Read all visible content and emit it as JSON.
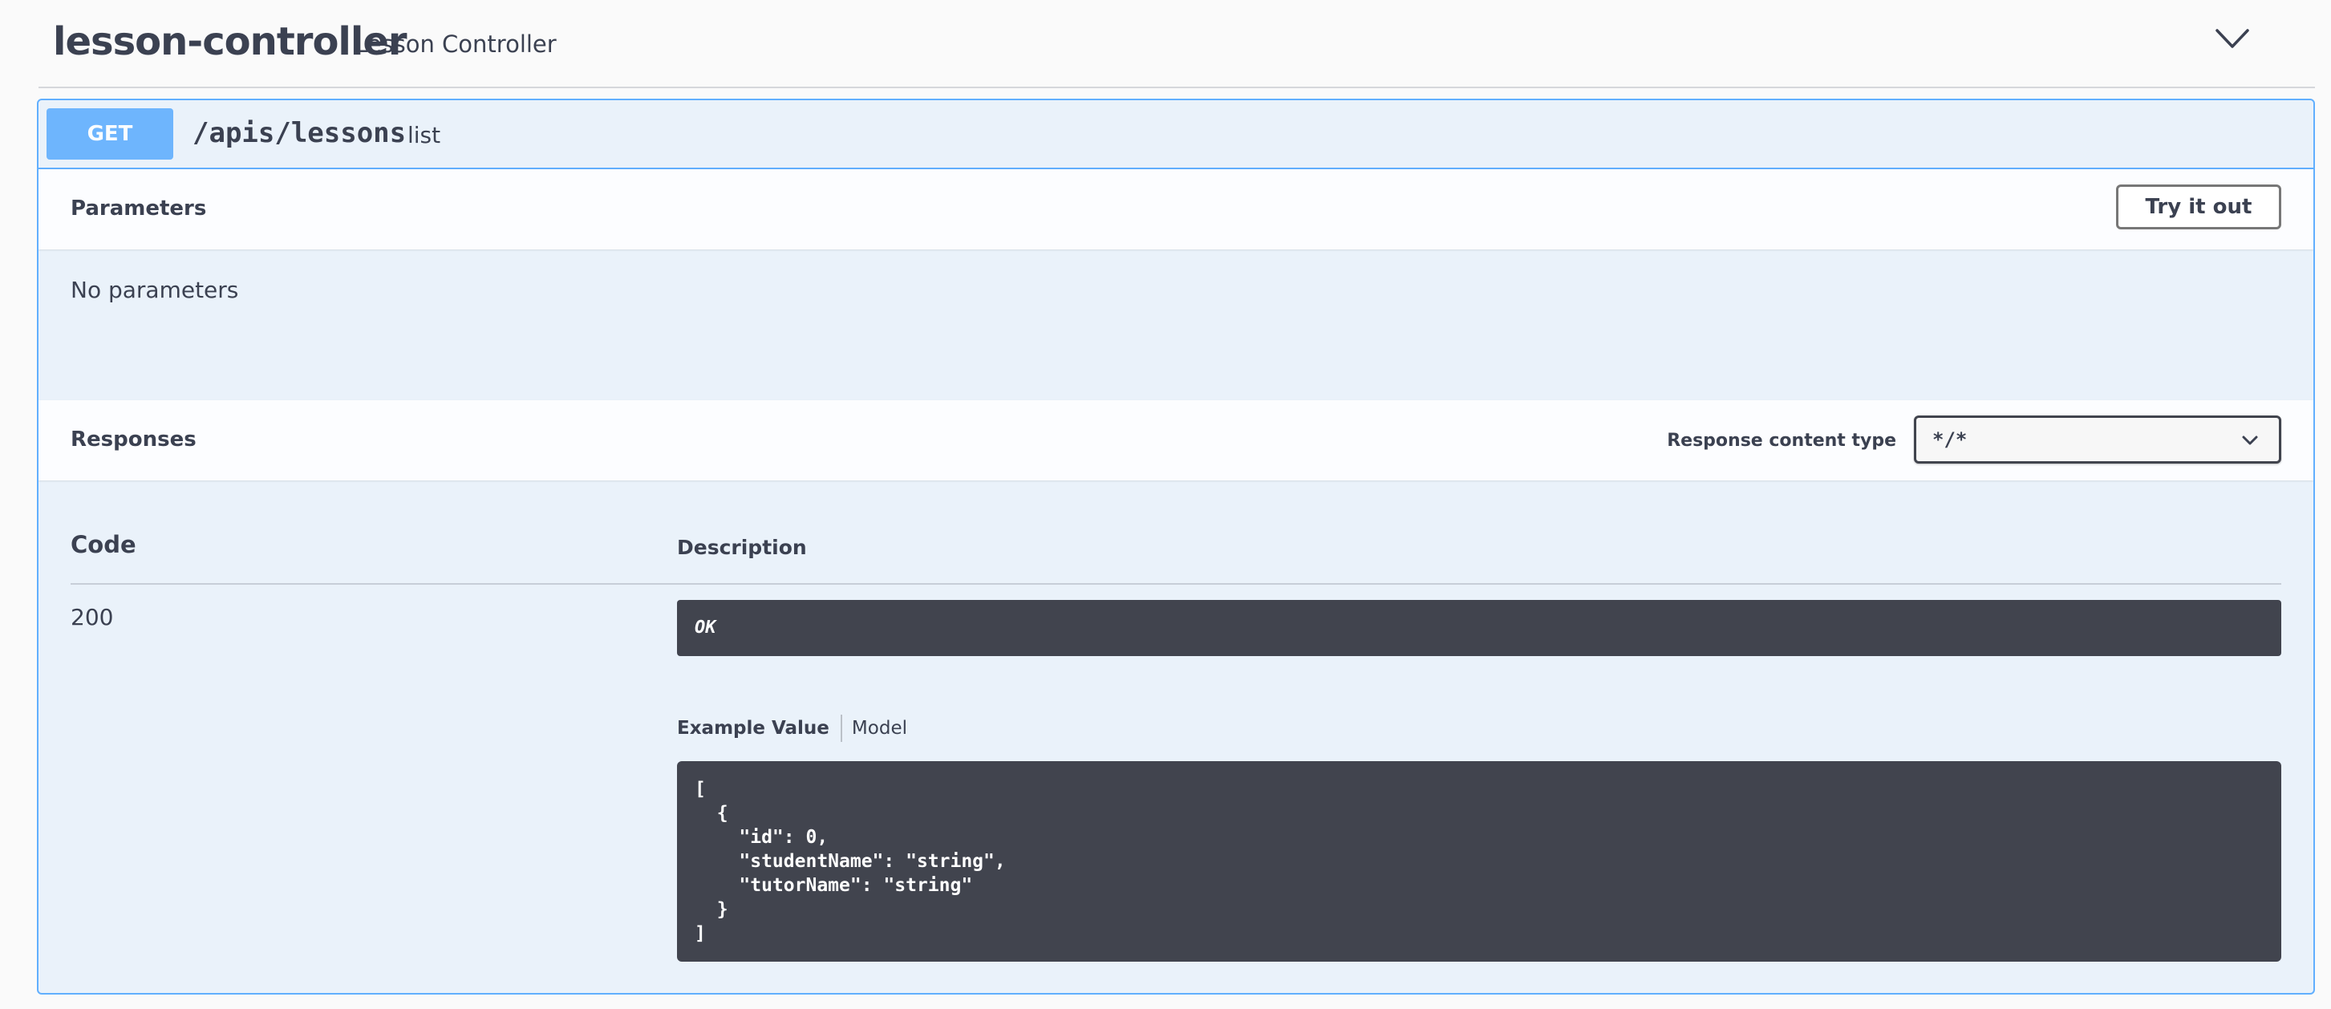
{
  "tag": {
    "name": "lesson-controller",
    "description": "Lesson Controller",
    "toggle_icon": "chevron-down-icon"
  },
  "operation": {
    "method": "GET",
    "path": "/apis/lessons",
    "summary": "list",
    "method_color": "#61affe"
  },
  "parameters": {
    "title": "Parameters",
    "try_button": "Try it out",
    "empty_text": "No parameters"
  },
  "responses": {
    "title": "Responses",
    "content_type_label": "Response content type",
    "content_type_value": "*/*",
    "columns": {
      "code": "Code",
      "description": "Description"
    },
    "rows": [
      {
        "code": "200",
        "description": "OK",
        "tabs": {
          "example": "Example Value",
          "model": "Model"
        },
        "example": "[\n  {\n    \"id\": 0,\n    \"studentName\": \"string\",\n    \"tutorName\": \"string\"\n  }\n]"
      }
    ]
  }
}
